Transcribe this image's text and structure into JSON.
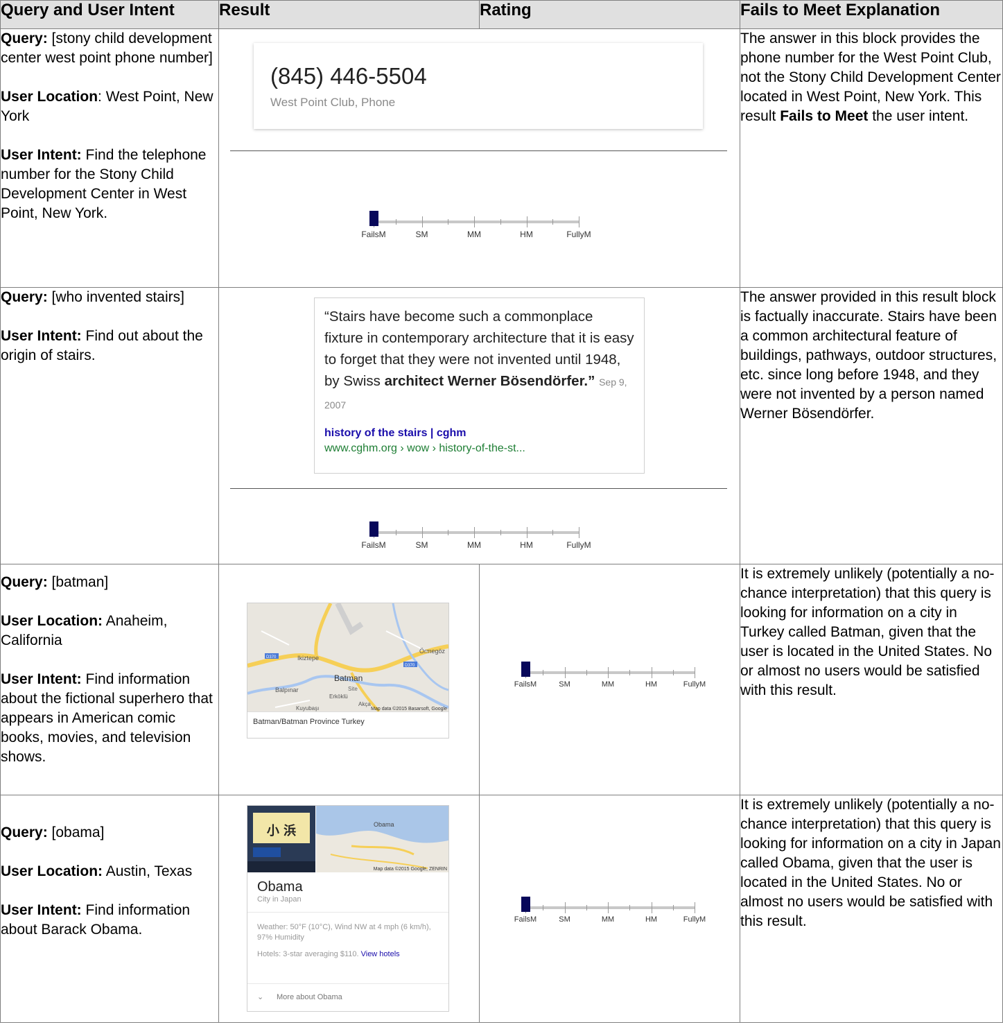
{
  "headers": {
    "query": "Query and User Intent",
    "result": "Result",
    "rating": "Rating",
    "explanation": "Fails to Meet Explanation"
  },
  "scale_labels": [
    "FailsM",
    "SM",
    "MM",
    "HM",
    "FullyM"
  ],
  "rows": [
    {
      "query_label": "Query:",
      "query_text": " [stony child development center west point phone number]",
      "location_label": "User Location",
      "location_text": ": West Point, New York",
      "intent_label": "User Intent:",
      "intent_text": " Find the telephone number for the Stony Child Development Center in West Point, New York.",
      "result": {
        "phone": "(845) 446-5504",
        "sub": "West Point Club, Phone"
      },
      "rating": "FailsM",
      "rating_level": 0,
      "explanation_pre": "The answer in this block provides the phone number for the West Point Club, not the Stony Child Development Center located in West Point, New York.  This result ",
      "explanation_bold": "Fails to Meet",
      "explanation_post": " the user intent."
    },
    {
      "query_label": "Query:",
      "query_text": " [who invented stairs]",
      "intent_label": "User Intent:",
      "intent_text": " Find out about the origin of stairs.",
      "result": {
        "quote_plain": "“Stairs have become such a commonplace fixture in contemporary architecture that it is easy to forget that they were not invented until 1948, by Swiss ",
        "quote_bold": "architect Werner Bösendörfer.”",
        "date": "Sep 9, 2007",
        "link_title": "history of the stairs | cghm",
        "link_url": "www.cghm.org › wow › history-of-the-st..."
      },
      "rating": "FailsM",
      "rating_level": 0,
      "explanation": "The answer provided in this result block is factually inaccurate.  Stairs have been a common architectural feature of buildings, pathways, outdoor structures, etc. since long before 1948, and they were not invented by a person named Werner Bösendörfer."
    },
    {
      "query_label": "Query:",
      "query_text": " [batman]",
      "location_label": "User Location:",
      "location_text": " Anaheim, California",
      "intent_label": "User Intent:",
      "intent_text": " Find information about the fictional superhero that appears in American comic books, movies, and television shows.",
      "result": {
        "map_labels": [
          "D370",
          "Ikiztepe",
          "Örmegöz",
          "D370",
          "Batman",
          "Site",
          "Balpınar",
          "Erköklü",
          "Akça",
          "Kuyubaşı"
        ],
        "map_credit": "Map data ©2015 Basarsoft, Google",
        "caption": "Batman/Batman Province Turkey"
      },
      "rating": "FailsM",
      "rating_level": 0,
      "explanation": "It is extremely unlikely (potentially a no-chance interpretation) that this query is looking for information on a city in Turkey called Batman, given that the user is located in the United States.  No or almost no users would be satisfied with this result."
    },
    {
      "query_label": "Query:",
      "query_text": " [obama]",
      "location_label": "User Location:",
      "location_text": " Austin, Texas",
      "intent_label": "User Intent:",
      "intent_text": " Find information about Barack Obama.",
      "result": {
        "sign_text": "小 浜",
        "map_label": "Obama",
        "map_credit": "Map data ©2015 Google, ZENRIN",
        "title": "Obama",
        "subtitle": "City in Japan",
        "weather": "Weather: 50°F (10°C), Wind NW at 4 mph (6 km/h), 97% Humidity",
        "hotels_pre": "Hotels: 3-star averaging $110. ",
        "hotels_link": "View hotels",
        "more": "More about Obama"
      },
      "rating": "FailsM",
      "rating_level": 0,
      "explanation": "It is extremely unlikely (potentially a no-chance interpretation) that this query is looking for information on a city in Japan called Obama, given that the user is located in the United States.  No or almost no users would be satisfied with this result."
    }
  ]
}
